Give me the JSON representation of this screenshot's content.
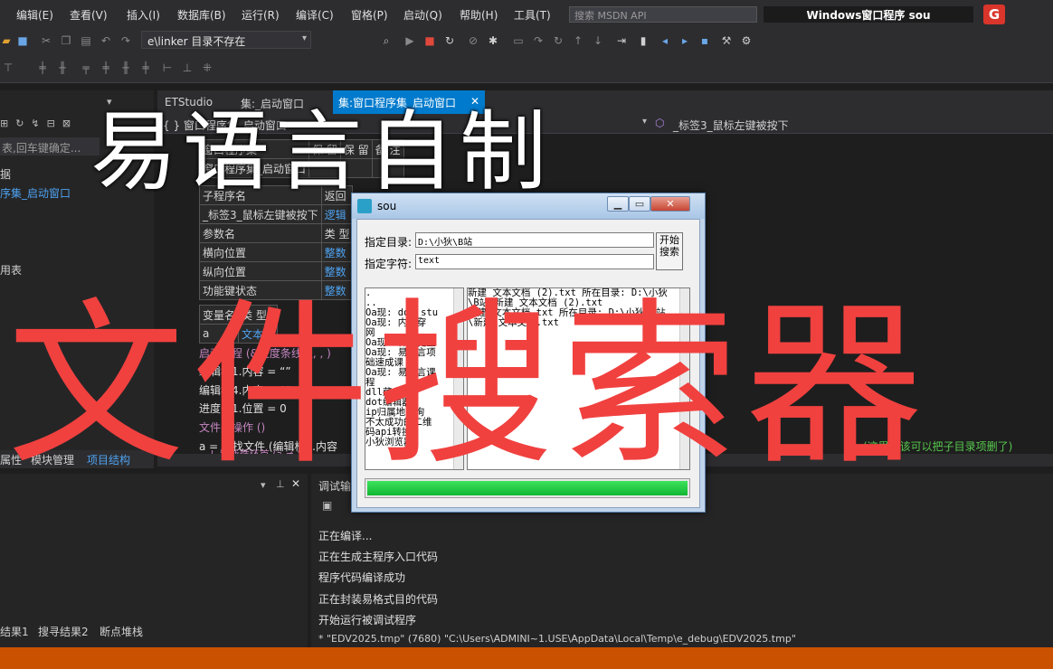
{
  "menu": {
    "items": [
      "编辑(E)",
      "查看(V)",
      "插入(I)",
      "数据库(B)",
      "运行(R)",
      "编译(C)",
      "窗格(P)",
      "启动(Q)",
      "帮助(H)",
      "工具(T)"
    ],
    "search_placeholder": "搜索 MSDN API",
    "window_title": "Windows窗口程序  sou",
    "logo": "G"
  },
  "toolbar": {
    "path_combo": "e\\linker 目录不存在"
  },
  "left_panel": {
    "search_placeholder": "表,回车键确定...",
    "tree": [
      "据",
      "序集_启动窗口",
      "用表"
    ],
    "tabs": [
      "属性",
      "模块管理",
      "项目结构"
    ]
  },
  "editor_tabs": {
    "tabs": [
      "ETStudio",
      "集:_启动窗口",
      "集:窗口程序集_启动窗口"
    ],
    "close": "✕",
    "nav_left": "{ }  窗口程序集_启动窗口",
    "nav_right": "_标签3_鼠标左键被按下"
  },
  "editor": {
    "table1": [
      [
        "窗口程序集",
        "保 留",
        "保 留",
        "备 注"
      ],
      [
        "窗口程序集_启动窗口",
        "",
        "",
        ""
      ]
    ],
    "table2": [
      [
        "子程序名",
        "返回"
      ],
      [
        "_标签3_鼠标左键被按下",
        "逻辑"
      ],
      [
        "参数名",
        "类 型"
      ],
      [
        "横向位置",
        "整数"
      ],
      [
        "纵向位置",
        "整数"
      ],
      [
        "功能键状态",
        "整数"
      ]
    ],
    "table3": [
      [
        "变量名",
        "类 型"
      ],
      [
        "a",
        "文本型"
      ]
    ],
    "code": [
      "启动线程 (&进度条线程, , )",
      "编辑框1.内容 = “”",
      "编辑框4.内容 = “”",
      "进度条1.位置 = 0",
      "文件夹操作 ()",
      "a = 寻找文件 (编辑框2.内容",
      "↓ 判断循环首 (a ≠ “”)"
    ],
    "comment": "(这里应该可以把子目录项删了)"
  },
  "bottom": {
    "left_tabs": [
      "结果1",
      "搜寻结果2",
      "断点堆栈"
    ],
    "right_title": "调试输出",
    "output": [
      "正在编译...",
      "正在生成主程序入口代码",
      "程序代码编译成功",
      "正在封装易格式目的代码",
      "开始运行被调试程序",
      "* \"EDV2025.tmp\" (7680) \"C:\\Users\\ADMINI~1.USE\\AppData\\Local\\Temp\\e_debug\\EDV2025.tmp\""
    ]
  },
  "dialog": {
    "title": "sou",
    "dir_label": "指定目录:",
    "dir_value": "D:\\小狄\\B站",
    "str_label": "指定字符:",
    "str_value": "text",
    "start_button": "开始\n搜索",
    "left_list": [
      ".",
      "..",
      "Oa现: dot_stu",
      "Oa现: 内网穿",
      "网",
      "Oa现: 神音健盘",
      "Oa现: 易语言项",
      "础速成课",
      "Oa现: 易语言课",
      "程",
      "dll藏文件",
      "dot编辑器",
      "ip归属地查询",
      "不太成功的二维",
      "码api转换",
      "小狄浏览器"
    ],
    "right_list": [
      "新建 文本文档 (2).txt 所在目录: D:\\小狄",
      "\\B站\\新建 文本文档 (2).txt",
      "新建 文本文档.txt 所在目录: D:\\小狄\\B站",
      "\\新建 文本文档.txt"
    ],
    "progress": 1.0
  },
  "overlay": {
    "top_text": "易语言自制",
    "big_text": "文件搜索器"
  },
  "colors": {
    "accent": "#007acc",
    "status": "#ca5100",
    "overlay_red": "#f0413f"
  }
}
